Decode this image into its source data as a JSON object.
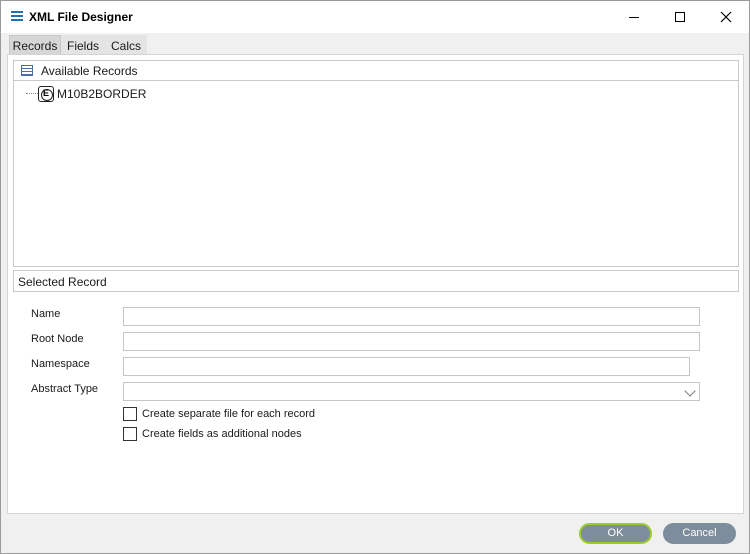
{
  "window": {
    "title": "XML File Designer",
    "icon": "app-menu-icon",
    "controls": [
      "minimize-icon",
      "maximize-icon",
      "close-icon"
    ]
  },
  "tabs": [
    {
      "label": "Records",
      "active": true
    },
    {
      "label": "Fields",
      "active": false
    },
    {
      "label": "Calcs",
      "active": false
    }
  ],
  "records_tree": {
    "header": "Available Records",
    "header_icon": "table-icon",
    "nodes": [
      {
        "label": "M10B2BORDER",
        "icon": "element-node-icon",
        "icon_letter": "E"
      }
    ]
  },
  "selected_record": {
    "section_label": "Selected Record",
    "fields": {
      "name": {
        "label": "Name",
        "value": ""
      },
      "root_node": {
        "label": "Root Node",
        "value": ""
      },
      "namespace": {
        "label": "Namespace",
        "value": ""
      },
      "abstract_type": {
        "label": "Abstract Type",
        "value": ""
      }
    },
    "checkboxes": [
      {
        "label": "Create separate file for each record",
        "checked": false
      },
      {
        "label": "Create fields as additional nodes",
        "checked": false
      }
    ]
  },
  "buttons": {
    "ok": "OK",
    "cancel": "Cancel"
  },
  "colors": {
    "accent": "#1f6fb5",
    "button_bg": "#7e8d9b",
    "focus_ring": "#9ccc2a"
  }
}
